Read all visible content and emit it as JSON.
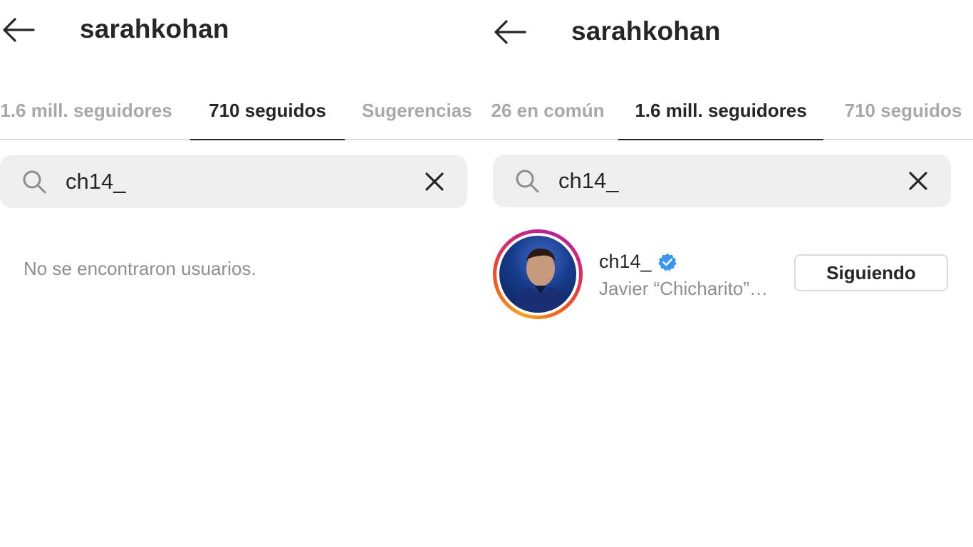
{
  "left_panel": {
    "title": "sarahkohan",
    "tabs": [
      {
        "label": "1.6 mill. seguidores"
      },
      {
        "label": "710 seguidos",
        "active": true
      },
      {
        "label": "Sugerencias"
      }
    ],
    "search": {
      "value": "ch14_",
      "icon": "search-icon",
      "clear_icon": "close-icon"
    },
    "empty_message": "No se encontraron usuarios."
  },
  "right_panel": {
    "title": "sarahkohan",
    "tabs": [
      {
        "label": "26 en común"
      },
      {
        "label": "1.6 mill. seguidores",
        "active": true
      },
      {
        "label": "710 seguidos"
      }
    ],
    "search": {
      "value": "ch14_",
      "icon": "search-icon",
      "clear_icon": "close-icon"
    },
    "results": [
      {
        "username": "ch14_",
        "verified": true,
        "full_name": "Javier “Chicharito”…",
        "button_label": "Siguiendo"
      }
    ]
  },
  "colors": {
    "text": "#262626",
    "muted": "#8e8e8e",
    "tab_inactive": "#a8a8a8",
    "search_bg": "#efefef",
    "verified": "#3897f0"
  }
}
